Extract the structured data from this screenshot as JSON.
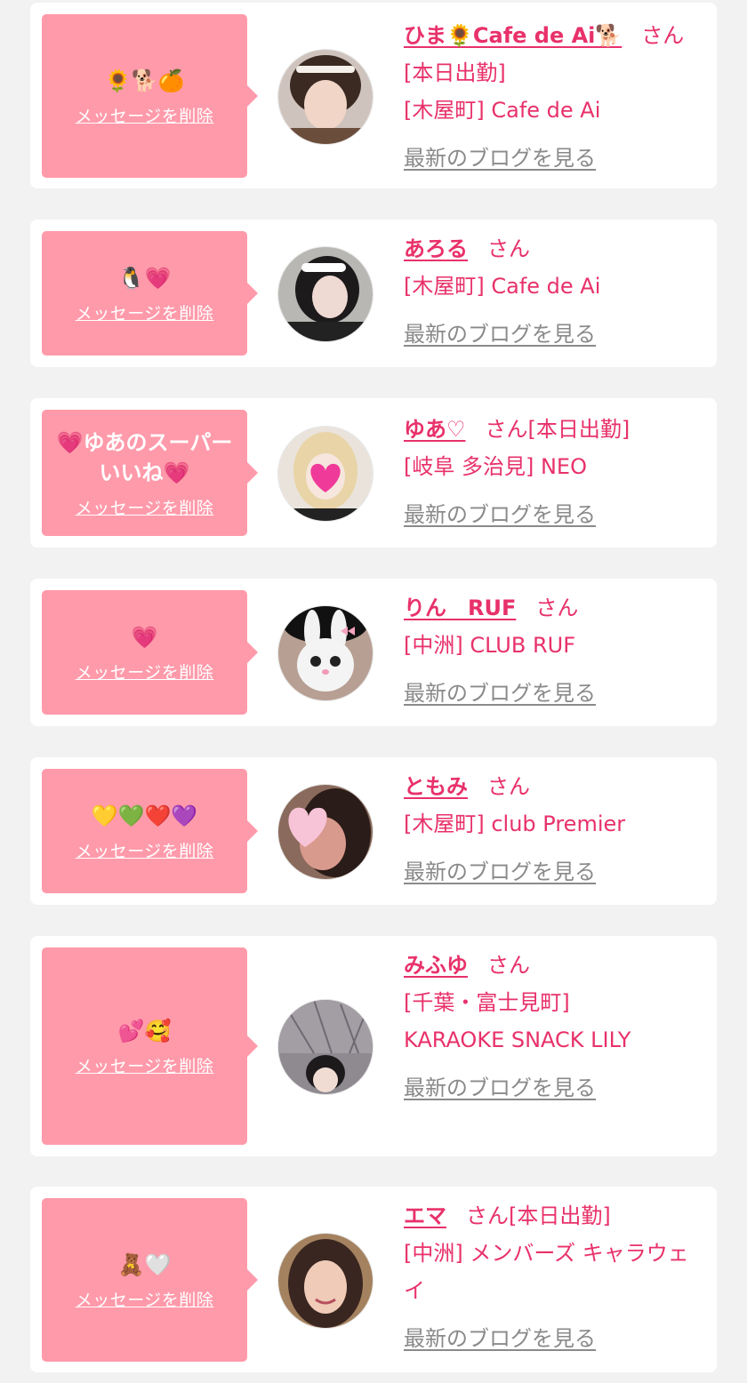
{
  "common": {
    "delete_label": "メッセージを削除",
    "san_label": "さん",
    "blog_label": "最新のブログを見る"
  },
  "colors": {
    "background": "#f2f2f2",
    "card": "#ffffff",
    "bubble": "#ff9aaa",
    "accent": "#e8316a",
    "link_gray": "#8a8a8a"
  },
  "messages": [
    {
      "message": "🌻🐕🍊",
      "name": "ひま🌻Cafe de Ai🐕",
      "status": "[本日出勤]",
      "location": "[木屋町] Cafe de Ai",
      "avatar_icon": "woman-with-headband-avatar-icon"
    },
    {
      "message": "🐧💗",
      "name": "あろる",
      "status": "",
      "location": "[木屋町] Cafe de Ai",
      "avatar_icon": "maid-costume-avatar-icon"
    },
    {
      "message": "💗ゆあのスーパーいいね💗",
      "name": "ゆあ♡",
      "status": "[本日出勤]",
      "location": "[岐阜 多治見] NEO",
      "avatar_icon": "blonde-woman-heart-covered-avatar-icon"
    },
    {
      "message": "💗",
      "name": "りん　RUF",
      "status": "",
      "location": "[中洲] CLUB RUF",
      "avatar_icon": "bunny-filter-avatar-icon"
    },
    {
      "message": "💛💚❤️💜",
      "name": "ともみ",
      "status": "",
      "location": "[木屋町] club Premier",
      "avatar_icon": "woman-heart-covered-avatar-icon"
    },
    {
      "message": "💕🥰",
      "name": "みふゆ",
      "status": "",
      "location": "[千葉・富士見町] KARAOKE SNACK LILY",
      "avatar_icon": "woman-under-umbrella-avatar-icon"
    },
    {
      "message": "🧸🤍",
      "name": "エマ",
      "status": "[本日出勤]",
      "location": "[中洲] メンバーズ キャラウェイ",
      "avatar_icon": "smiling-woman-avatar-icon"
    }
  ]
}
